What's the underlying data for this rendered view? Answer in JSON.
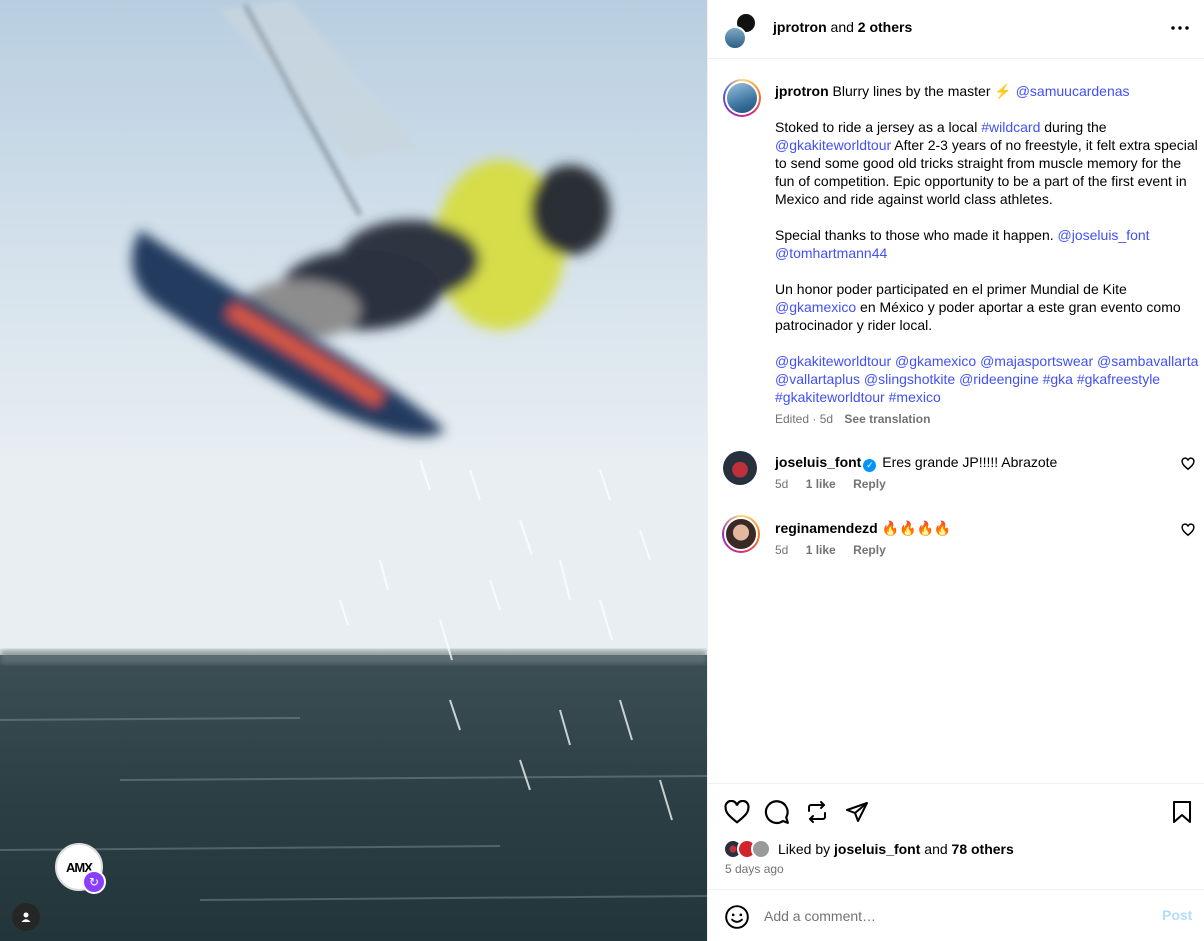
{
  "header": {
    "username": "jprotron",
    "joiner": "and",
    "others": "2 others"
  },
  "caption": {
    "username": "jprotron",
    "line1_text": "Blurry lines by the master",
    "line1_emoji": "⚡️",
    "line1_mention": "@samuucardenas",
    "p2_a": "Stoked to ride a jersey as a local",
    "p2_tag": "#wildcard",
    "p2_b": "during the",
    "p2_mention": "@gkakiteworldtour",
    "p2_c": "After 2-3 years of no freestyle, it felt extra special to send some good old tricks straight from muscle memory for the fun of competition. Epic opportunity to be a part of the first event in Mexico and ride against world class athletes.",
    "p3_a": "Special thanks to those who made it happen.",
    "p3_m1": "@joseluis_font",
    "p3_m2": "@tomhartmann44",
    "p4_a": "Un honor poder participated en el primer Mundial de Kite",
    "p4_mention": "@gkamexico",
    "p4_b": "en México y poder aportar a este gran evento como patrocinador y rider local.",
    "tags": [
      "@gkakiteworldtour",
      "@gkamexico",
      "@majasportswear",
      "@sambavallarta",
      "@vallartaplus",
      "@slingshotkite",
      "@rideengine",
      "#gka",
      "#gkafreestyle",
      "#gkakiteworldtour",
      "#mexico"
    ],
    "edited": "Edited · 5d",
    "see_translation": "See translation"
  },
  "comments": [
    {
      "username": "joseluis_font",
      "verified": true,
      "text": "Eres grande JP!!!!! Abrazote",
      "time": "5d",
      "likes": "1 like",
      "reply": "Reply"
    },
    {
      "username": "reginamendezd",
      "verified": false,
      "text": "🔥🔥🔥🔥",
      "time": "5d",
      "likes": "1 like",
      "reply": "Reply"
    }
  ],
  "likes": {
    "prefix": "Liked by",
    "user": "joseluis_font",
    "joiner": "and",
    "others": "78 others"
  },
  "post_time": "5 days ago",
  "composer": {
    "placeholder": "Add a comment…",
    "post_label": "Post"
  },
  "overlay": {
    "collab_logo_text": "AMX"
  },
  "colors": {
    "link": "#4150f7",
    "muted": "#737373",
    "post_disabled": "#b3dbff",
    "verified": "#0095f6"
  }
}
